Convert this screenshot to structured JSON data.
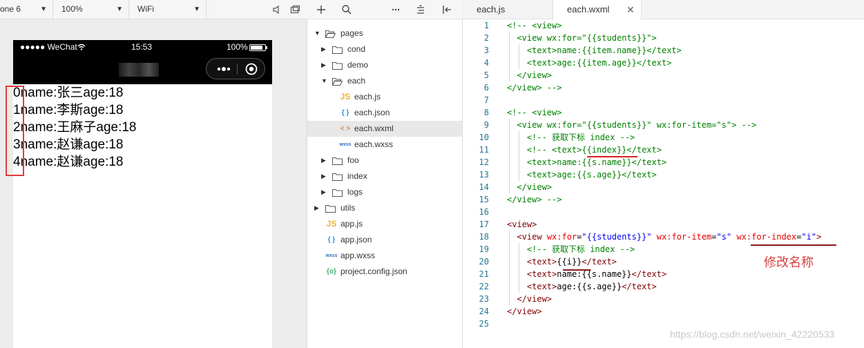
{
  "simulator": {
    "toolbar": {
      "device": "one 6",
      "zoom": "100%",
      "network": "WiFi"
    },
    "status_bar": {
      "carrier": "●●●●● WeChat",
      "time": "15:53",
      "battery": "100%"
    },
    "rows": [
      "0name:张三age:18",
      "1name:李斯age:18",
      "2name:王麻子age:18",
      "3name:赵谦age:18",
      "4name:赵谦age:18"
    ]
  },
  "explorer": {
    "tree": [
      {
        "label": "pages",
        "kind": "folder",
        "open": true,
        "depth": 0
      },
      {
        "label": "cond",
        "kind": "folder",
        "open": false,
        "depth": 1
      },
      {
        "label": "demo",
        "kind": "folder",
        "open": false,
        "depth": 1
      },
      {
        "label": "each",
        "kind": "folder",
        "open": true,
        "depth": 1
      },
      {
        "label": "each.js",
        "kind": "js",
        "depth": 2
      },
      {
        "label": "each.json",
        "kind": "json",
        "depth": 2
      },
      {
        "label": "each.wxml",
        "kind": "wxml",
        "depth": 2,
        "selected": true
      },
      {
        "label": "each.wxss",
        "kind": "wxss",
        "depth": 2
      },
      {
        "label": "foo",
        "kind": "folder",
        "open": false,
        "depth": 1
      },
      {
        "label": "index",
        "kind": "folder",
        "open": false,
        "depth": 1
      },
      {
        "label": "logs",
        "kind": "folder",
        "open": false,
        "depth": 1
      },
      {
        "label": "utils",
        "kind": "folder",
        "open": false,
        "depth": 0
      },
      {
        "label": "app.js",
        "kind": "js",
        "depth": 0
      },
      {
        "label": "app.json",
        "kind": "json",
        "depth": 0
      },
      {
        "label": "app.wxss",
        "kind": "wxss",
        "depth": 0
      },
      {
        "label": "project.config.json",
        "kind": "config",
        "depth": 0
      }
    ],
    "icon_text": {
      "js": "JS",
      "json": "{ }",
      "wxml": "< >",
      "wxss": "wxss",
      "config": "{o}"
    }
  },
  "editor": {
    "tabs": [
      {
        "label": "each.js",
        "active": false
      },
      {
        "label": "each.wxml",
        "active": true
      }
    ],
    "close_glyph": "✕",
    "lines": [
      [
        [
          "c-comment",
          "<!-- <view>"
        ]
      ],
      [
        [
          "c-comment",
          "  <view wx:for=\"{{students}}\">"
        ]
      ],
      [
        [
          "c-comment",
          "    <text>name:{{item.name}}</text>"
        ]
      ],
      [
        [
          "c-comment",
          "    <text>age:{{item.age}}</text>"
        ]
      ],
      [
        [
          "c-comment",
          "  </view>"
        ]
      ],
      [
        [
          "c-comment",
          "</view> -->"
        ]
      ],
      [
        [
          "c-text",
          ""
        ]
      ],
      [
        [
          "c-comment",
          "<!-- <view>"
        ]
      ],
      [
        [
          "c-comment",
          "  <view wx:for=\"{{students}}\" wx:for-item=\"s\"> -->"
        ]
      ],
      [
        [
          "c-comment",
          "    <!-- 获取下标 index -->"
        ]
      ],
      [
        [
          "c-comment",
          "    <!-- <text>{{index}}</text>"
        ]
      ],
      [
        [
          "c-comment",
          "    <text>name:{{s.name}}</text>"
        ]
      ],
      [
        [
          "c-comment",
          "    <text>age:{{s.age}}</text>"
        ]
      ],
      [
        [
          "c-comment",
          "  </view>"
        ]
      ],
      [
        [
          "c-comment",
          "</view> -->"
        ]
      ],
      [
        [
          "c-text",
          ""
        ]
      ],
      [
        [
          "c-tag",
          "<view>"
        ]
      ],
      [
        [
          "c-text",
          "  "
        ],
        [
          "c-tag",
          "<view "
        ],
        [
          "c-attr",
          "wx:for"
        ],
        [
          "c-text",
          "="
        ],
        [
          "c-str",
          "\"{{students}}\""
        ],
        [
          "c-text",
          " "
        ],
        [
          "c-attr",
          "wx:for-item"
        ],
        [
          "c-text",
          "="
        ],
        [
          "c-str",
          "\"s\""
        ],
        [
          "c-text",
          " "
        ],
        [
          "c-attr",
          "wx:for-index"
        ],
        [
          "c-text",
          "="
        ],
        [
          "c-str",
          "\"i\""
        ],
        [
          "c-tag",
          ">"
        ]
      ],
      [
        [
          "c-text",
          "    "
        ],
        [
          "c-comment",
          "<!-- 获取下标 index -->"
        ]
      ],
      [
        [
          "c-text",
          "    "
        ],
        [
          "c-tag",
          "<text>"
        ],
        [
          "c-text",
          "{{i}}"
        ],
        [
          "c-tag",
          "</text>"
        ]
      ],
      [
        [
          "c-text",
          "    "
        ],
        [
          "c-tag",
          "<text>"
        ],
        [
          "c-text",
          "name:{{s.name}}"
        ],
        [
          "c-tag",
          "</text>"
        ]
      ],
      [
        [
          "c-text",
          "    "
        ],
        [
          "c-tag",
          "<text>"
        ],
        [
          "c-text",
          "age:{{s.age}}"
        ],
        [
          "c-tag",
          "</text>"
        ]
      ],
      [
        [
          "c-text",
          "  "
        ],
        [
          "c-tag",
          "</view>"
        ]
      ],
      [
        [
          "c-tag",
          "</view>"
        ]
      ],
      [
        [
          "c-text",
          ""
        ]
      ]
    ],
    "annotation": "修改名称",
    "watermark": "https://blog.csdn.net/weixin_42220533"
  }
}
